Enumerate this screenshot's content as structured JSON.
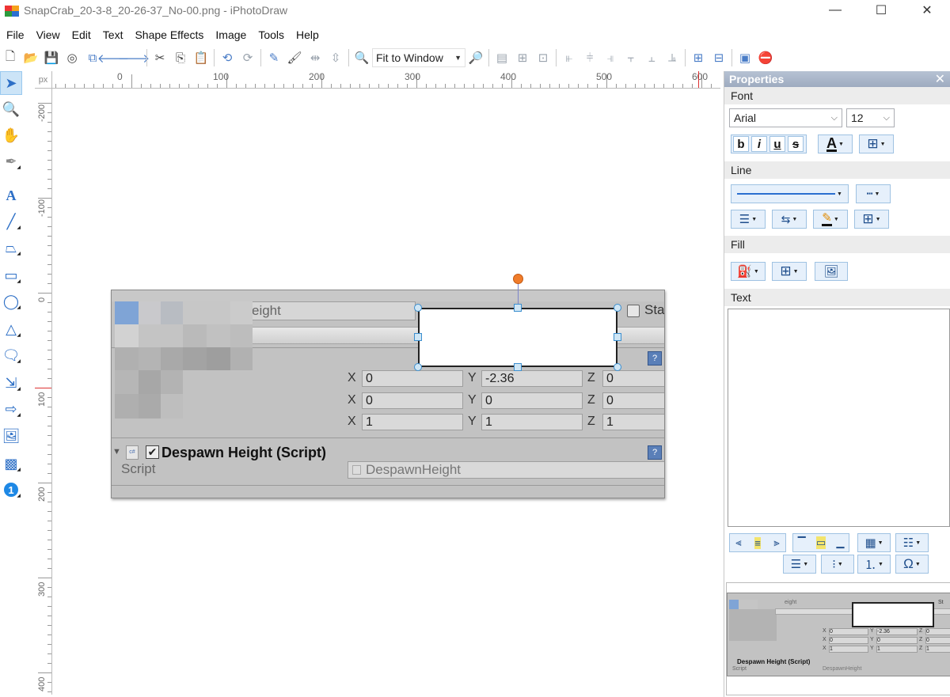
{
  "window": {
    "title": "SnapCrab_20-3-8_20-26-37_No-00.png - iPhotoDraw",
    "minimize": "—",
    "maximize": "☐",
    "close": "✕"
  },
  "menu": [
    "File",
    "View",
    "Edit",
    "Text",
    "Shape Effects",
    "Image",
    "Tools",
    "Help"
  ],
  "toolbar": {
    "zoom_value": "Fit to Window"
  },
  "ruler": {
    "unit": "px",
    "top_labels": [
      "0",
      "100",
      "200",
      "300",
      "400",
      "500",
      "600"
    ],
    "left_labels": [
      "-200",
      "-100",
      "0",
      "100",
      "200",
      "300",
      "400"
    ]
  },
  "screenshot": {
    "field_top_label": "eight",
    "static_label": "Sta",
    "rows": [
      {
        "x": "0",
        "y": "-2.36",
        "z": "0"
      },
      {
        "x": "0",
        "y": "0",
        "z": "0"
      },
      {
        "x": "1",
        "y": "1",
        "z": "1"
      }
    ],
    "axis_x": "X",
    "axis_y": "Y",
    "axis_z": "Z",
    "component_title": "Despawn Height (Script)",
    "script_label": "Script",
    "script_value": "DespawnHeight",
    "cs_badge": "c#",
    "help_icon_label": "?"
  },
  "properties": {
    "title": "Properties",
    "close": "✕",
    "font_section": "Font",
    "font_name": "Arial",
    "font_size": "12",
    "line_section": "Line",
    "fill_section": "Fill",
    "text_section": "Text",
    "bold": "b",
    "italic": "i",
    "underline": "u",
    "strike": "s",
    "font_color_glyph": "A",
    "symbol_glyph": "Ω"
  },
  "preview": {
    "field_top_label": "eight",
    "static_label": "St",
    "rows": [
      {
        "x": "0",
        "y": "-2.36",
        "z": "0"
      },
      {
        "x": "0",
        "y": "0",
        "z": "0"
      },
      {
        "x": "1",
        "y": "1",
        "z": "1"
      }
    ],
    "axis_x": "X",
    "axis_y": "Y",
    "axis_z": "Z",
    "component_title": "Despawn Height (Script)",
    "script_label": "Script",
    "script_value": "DespawnHeight"
  }
}
